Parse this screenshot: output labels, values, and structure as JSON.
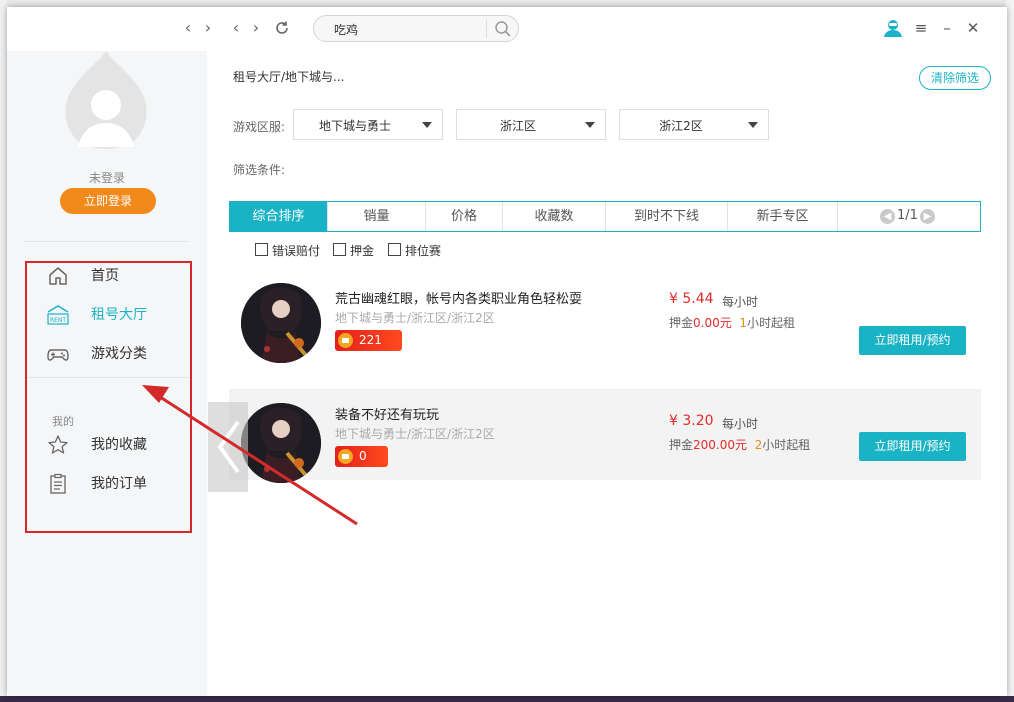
{
  "titlebar": {
    "search_value": "吃鸡",
    "icons": [
      "back-arrow",
      "forward-arrow",
      "refresh",
      "search",
      "user",
      "menu",
      "minimize",
      "close"
    ]
  },
  "sidebar": {
    "login_status": "未登录",
    "login_button": "立即登录",
    "items": [
      {
        "label": "首页",
        "icon": "home-icon"
      },
      {
        "label": "租号大厅",
        "icon": "rent-icon",
        "icon_text": "RENT"
      },
      {
        "label": "游戏分类",
        "icon": "gamepad-icon"
      }
    ],
    "section_mine": "我的",
    "mine_items": [
      {
        "label": "我的收藏",
        "icon": "star-icon"
      },
      {
        "label": "我的订单",
        "icon": "order-icon"
      }
    ]
  },
  "content": {
    "breadcrumb": "租号大厅/地下城与...",
    "clear_filter": "清除筛选",
    "region_label": "游戏区服:",
    "dropdowns": [
      "地下城与勇士",
      "浙江区",
      "浙江2区"
    ],
    "filter_label": "筛选条件:",
    "sort_tabs": [
      "综合排序",
      "销量",
      "价格",
      "收藏数",
      "到时不下线",
      "新手专区"
    ],
    "pager": "1/1",
    "checkboxes": [
      "错误赔付",
      "押金",
      "排位赛"
    ],
    "items": [
      {
        "title": "荒古幽魂红眼，帐号内各类职业角色轻松耍",
        "subtitle": "地下城与勇士/浙江区/浙江2区",
        "badge_count": "221",
        "price": "¥ 5.44",
        "per_hour": "每小时",
        "deposit_prefix": "押金",
        "deposit_amount": "0.00元",
        "min_hours": "1",
        "min_suffix": "小时起租",
        "button": "立即租用/预约"
      },
      {
        "title": "装备不好还有玩玩",
        "subtitle": "地下城与勇士/浙江区/浙江2区",
        "badge_count": "0",
        "price": "¥ 3.20",
        "per_hour": "每小时",
        "deposit_prefix": "押金",
        "deposit_amount": "200.00元",
        "min_hours": "2",
        "min_suffix": "小时起租",
        "button": "立即租用/预约"
      }
    ]
  },
  "colors": {
    "accent": "#1ab3c6",
    "login_button": "#f28a1b",
    "price": "#e52a2a",
    "annotation": "#d22a2a"
  }
}
